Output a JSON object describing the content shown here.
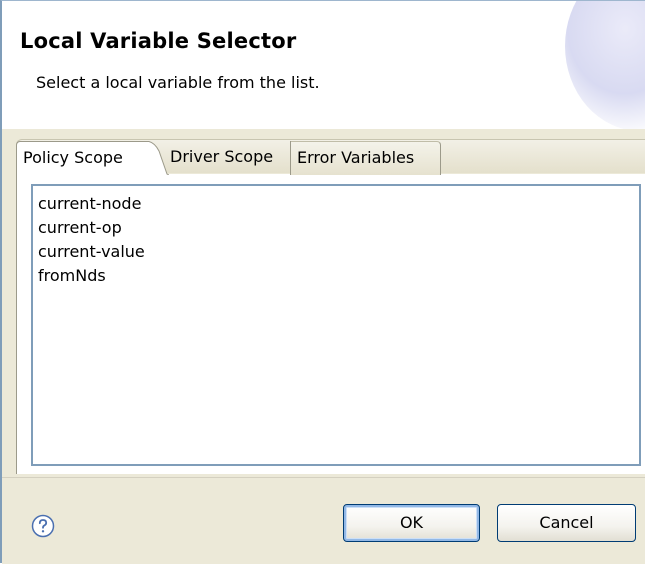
{
  "dialog": {
    "title": "Local Variable Selector",
    "subtitle": "Select a local variable from the list."
  },
  "tabs": [
    {
      "label": "Policy Scope",
      "selected": true
    },
    {
      "label": "Driver Scope",
      "selected": false
    },
    {
      "label": "Error Variables",
      "selected": false
    }
  ],
  "variables": [
    "current-node",
    "current-op",
    "current-value",
    "fromNds"
  ],
  "footer": {
    "help_icon": "question-mark-circle-icon",
    "ok_label": "OK",
    "cancel_label": "Cancel"
  },
  "colors": {
    "dialog_background": "#ece9d8",
    "list_border": "#7f9db9",
    "button_border": "#003c74",
    "help_icon": "#4a6fb0"
  }
}
